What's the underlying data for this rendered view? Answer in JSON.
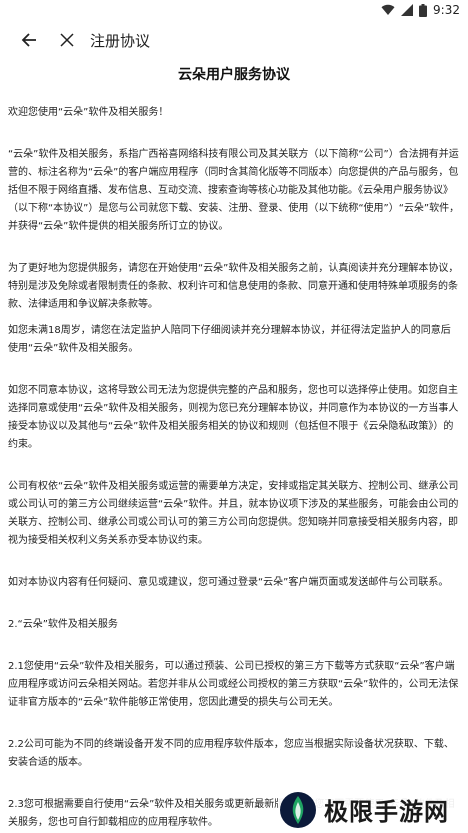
{
  "status_bar": {
    "time": "9:32"
  },
  "app_bar": {
    "title": "注册协议"
  },
  "document": {
    "title": "云朵用户服务协议",
    "paragraphs": [
      "欢迎您使用“云朵”软件及相关服务！",
      "“云朵”软件及相关服务，系指广西裕喜网络科技有限公司及其关联方（以下简称“公司”）合法拥有并运营的、标注名称为“云朵”的客户端应用程序（同时含其简化版等不同版本）向您提供的产品与服务，包括但不限于网络直播、发布信息、互动交流、搜索查询等核心功能及其他功能。《云朵用户服务协议》（以下称“本协议”）是您与公司就您下载、安装、注册、登录、使用（以下统称“使用”）“云朵”软件，并获得“云朵”软件提供的相关服务所订立的协议。",
      "为了更好地为您提供服务，请您在开始使用“云朵”软件及相关服务之前，认真阅读并充分理解本协议，特别是涉及免除或者限制责任的条款、权利许可和信息使用的条款、同意开通和使用特殊单项服务的条款、法律适用和争议解决条款等。",
      "如您未满18周岁，请您在法定监护人陪同下仔细阅读并充分理解本协议，并征得法定监护人的同意后使用“云朵”软件及相关服务。",
      "如您不同意本协议，这将导致公司无法为您提供完整的产品和服务，您也可以选择停止使用。如您自主选择同意或使用“云朵”软件及相关服务，则视为您已充分理解本协议，并同意作为本协议的一方当事人接受本协议以及其他与“云朵”软件及相关服务相关的协议和规则（包括但不限于《云朵隐私政策》）的约束。",
      "公司有权依“云朵”软件及相关服务或运营的需要单方决定，安排或指定其关联方、控制公司、继承公司或公司认可的第三方公司继续运营“云朵”软件。并且，就本协议项下涉及的某些服务，可能会由公司的关联方、控制公司、继承公司或公司认可的第三方公司向您提供。您知晓并同意接受相关服务内容，即视为接受相关权利义务关系亦受本协议约束。",
      "如对本协议内容有任何疑问、意见或建议，您可通过登录“云朵”客户端页面或发送邮件与公司联系。",
      "2.“云朵”软件及相关服务",
      "2.1您使用“云朵”软件及相关服务，可以通过预装、公司已授权的第三方下载等方式获取“云朵”客户端应用程序或访问云朵相关网站。若您并非从公司或经公司授权的第三方获取“云朵”软件的，公司无法保证非官方版本的“云朵”软件能够正常使用，您因此遭受的损失与公司无关。",
      "2.2公司可能为不同的终端设备开发不同的应用程序软件版本，您应当根据实际设备状况获取、下载、安装合适的版本。",
      "2.3您可根据需要自行使用“云朵”软件及相关服务或更新最新版本，如您不再需要使用“云朵”软件及相关服务，您也可自行卸载相应的应用程序软件。"
    ]
  },
  "watermark": {
    "text": "极限手游网"
  }
}
